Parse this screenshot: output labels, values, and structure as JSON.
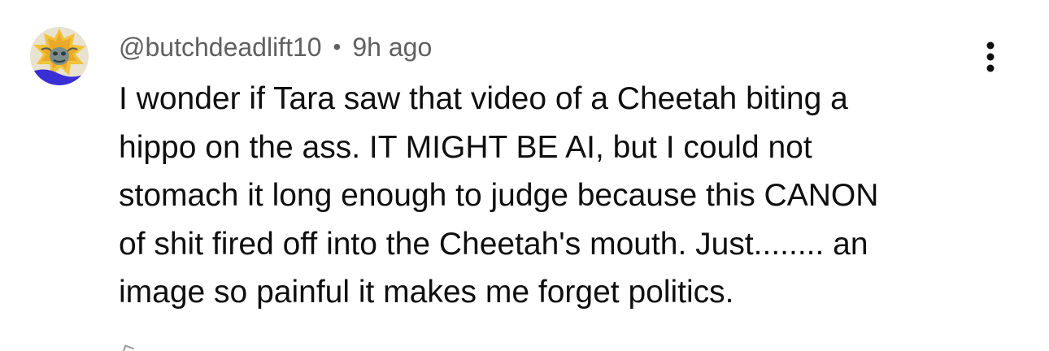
{
  "comment": {
    "author": "@butchdeadlift10",
    "separator": "•",
    "timestamp": "9h ago",
    "text_lines": [
      "I wonder if Tara saw that video of a Cheetah biting a",
      "hippo on the ass. IT MIGHT BE AI, but I could not",
      "stomach it long enough to judge because this CANON",
      "of shit fired off into the Cheetah's mouth. Just........ an",
      "image so painful it makes me forget politics."
    ],
    "menu_icon": "more-vert-icon",
    "avatar_icon": "avatar-image"
  },
  "colors": {
    "meta_text": "#606060",
    "body_text": "#0f0f0f",
    "background": "#ffffff",
    "avatar_yellow": "#f2c23c",
    "avatar_blue": "#3a2fd4"
  }
}
